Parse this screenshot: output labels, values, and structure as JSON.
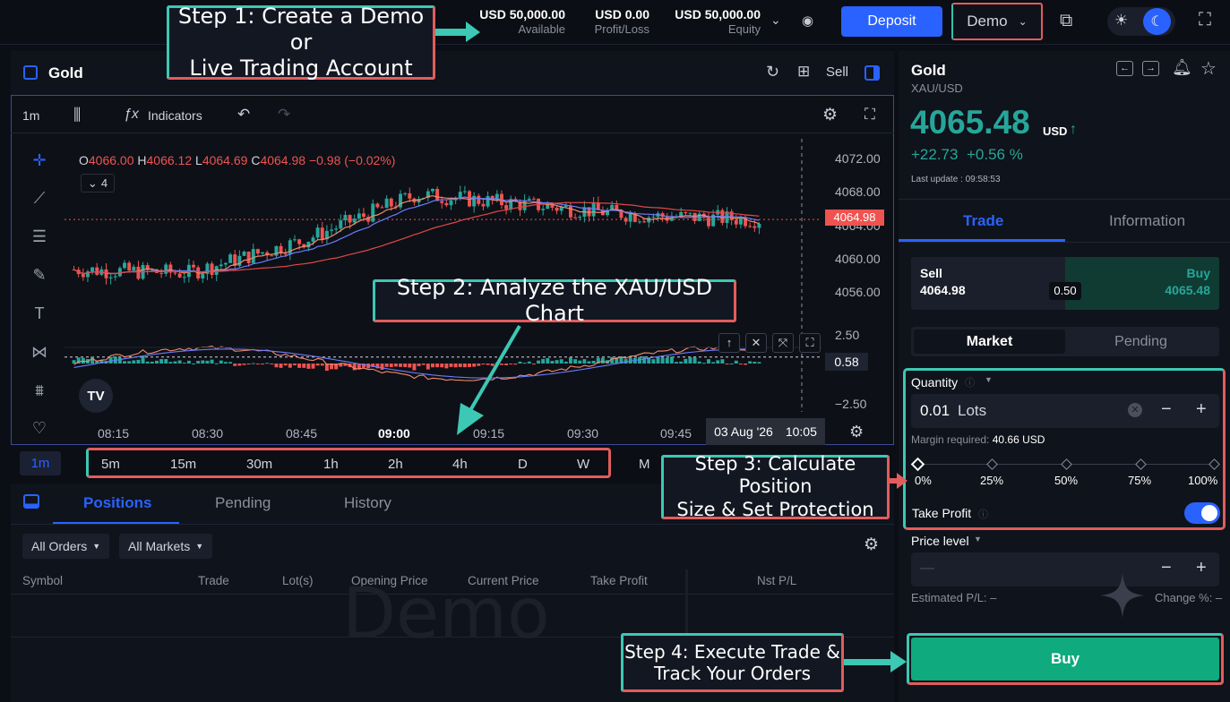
{
  "steps": {
    "s1_line1": "Step 1: Create a Demo or",
    "s1_line2": "Live Trading Account",
    "s2": "Step 2: Analyze the XAU/USD Chart",
    "s3_line1": "Step 3: Calculate Position",
    "s3_line2": "Size & Set Protection",
    "s4_line1": "Step 4: Execute Trade &",
    "s4_line2": "Track Your Orders"
  },
  "account": {
    "available_value": "USD 50,000.00",
    "available_label": "Available",
    "pl_value": "USD 0.00",
    "pl_label": "Profit/Loss",
    "equity_value": "USD 50,000.00",
    "equity_label": "Equity",
    "deposit_label": "Deposit",
    "mode_label": "Demo"
  },
  "chart_header": {
    "symbol": "Gold",
    "sell_label": "Sell",
    "interval": "1m",
    "indicators_label": "Indicators"
  },
  "ohlc": {
    "o_label": "O",
    "o": "4066.00",
    "h_label": "H",
    "h": "4066.12",
    "l_label": "L",
    "l": "4064.69",
    "c_label": "C",
    "c": "4064.98",
    "change": "−0.98 (−0.02%)",
    "count": "4"
  },
  "price_axis": [
    "4072.00",
    "4068.00",
    "4064.00",
    "4060.00",
    "4056.00"
  ],
  "last_price_tag": "4064.98",
  "macd_axis": [
    "2.50",
    "0.58",
    "−2.50"
  ],
  "time_axis": [
    "08:15",
    "08:30",
    "08:45",
    "09:00",
    "09:15",
    "09:30",
    "09:45"
  ],
  "crosshair_date": "03 Aug '26",
  "crosshair_time": "10:05",
  "timeframes": {
    "active": "1m",
    "items": [
      "5m",
      "15m",
      "30m",
      "1h",
      "2h",
      "4h",
      "D",
      "W"
    ],
    "extra": "M"
  },
  "orders": {
    "tabs": [
      "Positions",
      "Pending",
      "History"
    ],
    "filter_orders": "All Orders",
    "filter_markets": "All Markets",
    "columns": [
      "Symbol",
      "Trade",
      "Lot(s)",
      "Opening Price",
      "Current Price",
      "Take Profit",
      "Nst P/L"
    ],
    "watermark": "Demo"
  },
  "instrument": {
    "name": "Gold",
    "pair": "XAU/USD",
    "price": "4065.48",
    "currency": "USD",
    "change": "+22.73",
    "change_pct": "+0.56 %",
    "last_update": "Last update : 09:58:53"
  },
  "panel_tabs": [
    "Trade",
    "Information"
  ],
  "quote": {
    "sell_label": "Sell",
    "sell_price": "4064.98",
    "spread": "0.50",
    "buy_label": "Buy",
    "buy_price": "4065.48"
  },
  "order_type": [
    "Market",
    "Pending"
  ],
  "quantity": {
    "label": "Quantity",
    "value": "0.01",
    "unit": "Lots",
    "margin_label": "Margin required:",
    "margin_value": "40.66 USD",
    "steps": [
      "0%",
      "25%",
      "50%",
      "75%",
      "100%"
    ],
    "slider_fraction": 0
  },
  "take_profit": {
    "label": "Take Profit",
    "enabled": true
  },
  "price_level": {
    "label": "Price level",
    "value": "—",
    "est_pl": "Estimated P/L: –",
    "change": "Change %: –"
  },
  "buy_button": "Buy",
  "chart_data": {
    "type": "candlestick",
    "symbol": "XAU/USD",
    "interval": "1m",
    "x": [
      "08:15",
      "08:30",
      "08:45",
      "09:00",
      "09:15",
      "09:30",
      "09:45"
    ],
    "ylim": [
      4054,
      4074
    ],
    "approx_close": [
      4058.0,
      4057.5,
      4062.0,
      4068.5,
      4067.0,
      4065.5,
      4064.98
    ],
    "last": 4064.98,
    "macd_range": [
      -2.5,
      2.5
    ],
    "macd_last": 0.58
  },
  "colors": {
    "up": "#26a69a",
    "down": "#ef5350",
    "accent": "#2962ff",
    "buy": "#0faa7d",
    "step_border_a": "#3cc8b4",
    "step_border_b": "#e25c5c"
  }
}
